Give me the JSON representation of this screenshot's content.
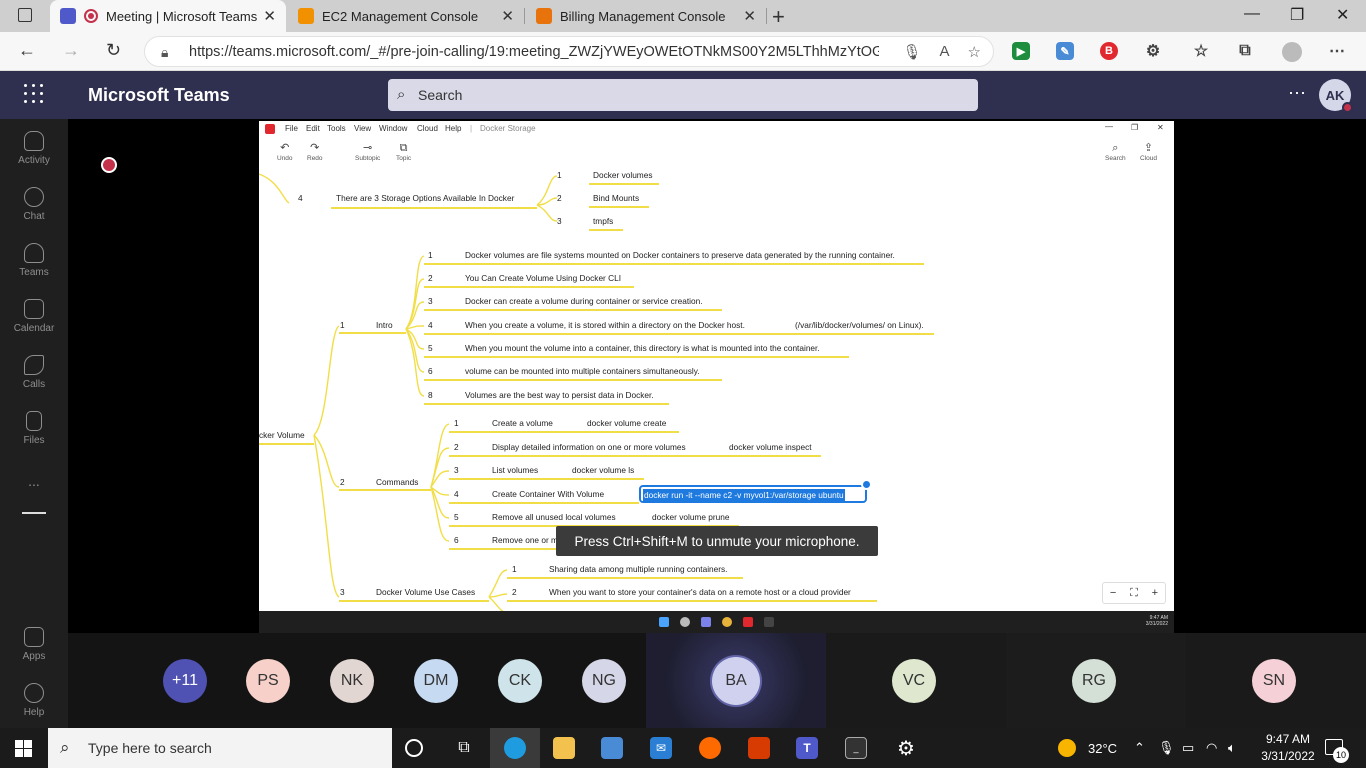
{
  "browser": {
    "tabs": [
      {
        "label": "Meeting | Microsoft Teams",
        "active": true
      },
      {
        "label": "EC2 Management Console",
        "active": false
      },
      {
        "label": "Billing Management Console",
        "active": false
      }
    ],
    "url": "https://teams.microsoft.com/_#/pre-join-calling/19:meeting_ZWZjYWEyOWEtOTNkMS00Y2M5LThhMzYtOGY..."
  },
  "teams": {
    "title": "Microsoft Teams",
    "search_placeholder": "Search",
    "user_initials": "AK",
    "rail": [
      {
        "label": "Activity"
      },
      {
        "label": "Chat"
      },
      {
        "label": "Teams"
      },
      {
        "label": "Calendar"
      },
      {
        "label": "Calls"
      },
      {
        "label": "Files"
      },
      {
        "label": "Apps"
      },
      {
        "label": "Help"
      }
    ],
    "more_label": "..."
  },
  "shared_app": {
    "menus": [
      "File",
      "Edit",
      "Tools",
      "View",
      "Window",
      "Cloud",
      "Help"
    ],
    "document_title": "Docker Storage",
    "toolbar": [
      {
        "label": "Undo",
        "icon": "undo-icon"
      },
      {
        "label": "Redo",
        "icon": "redo-icon"
      },
      {
        "label": "Subtopic",
        "icon": "subtopic-icon"
      },
      {
        "label": "Topic",
        "icon": "topic-icon"
      },
      {
        "label": "Search",
        "icon": "search-icon"
      },
      {
        "label": "Cloud",
        "icon": "cloud-upload-icon"
      }
    ],
    "mindmap": {
      "storage": {
        "num": "4",
        "title": "There are 3 Storage Options Available In Docker",
        "items": [
          {
            "num": "1",
            "text": "Docker volumes"
          },
          {
            "num": "2",
            "text": "Bind Mounts"
          },
          {
            "num": "3",
            "text": "tmpfs"
          }
        ]
      },
      "root": "cker Volume",
      "intro": {
        "num": "1",
        "title": "Intro",
        "items": [
          {
            "num": "1",
            "text": "Docker volumes are file systems mounted on Docker containers to preserve data generated by the running container."
          },
          {
            "num": "2",
            "text": "You Can Create Volume Using Docker CLI"
          },
          {
            "num": "3",
            "text": "Docker can create a volume during container or service creation."
          },
          {
            "num": "4",
            "text": "When you create a volume, it is stored within a directory on the Docker host.",
            "extra": "(/var/lib/docker/volumes/ on Linux)."
          },
          {
            "num": "5",
            "text": "When you mount the volume into a container, this directory is what is mounted into the container."
          },
          {
            "num": "6",
            "text": "volume can be mounted into multiple containers simultaneously."
          },
          {
            "num": "8",
            "text": "Volumes are the best way to persist data in Docker."
          }
        ]
      },
      "commands": {
        "num": "2",
        "title": "Commands",
        "items": [
          {
            "num": "1",
            "text": "Create a volume",
            "cmd": "docker volume create"
          },
          {
            "num": "2",
            "text": "Display detailed information on one or more volumes",
            "cmd": "docker volume inspect"
          },
          {
            "num": "3",
            "text": "List volumes",
            "cmd": "docker volume ls"
          },
          {
            "num": "4",
            "text": "Create Container With Volume",
            "cmd": "docker run -it --name c2 -v myvol1:/var/storage  ubuntu"
          },
          {
            "num": "5",
            "text": "Remove all unused local volumes",
            "cmd": "docker volume prune"
          },
          {
            "num": "6",
            "text": "Remove one or m",
            "cmd": ""
          }
        ]
      },
      "usecases": {
        "num": "3",
        "title": "Docker Volume Use Cases",
        "items": [
          {
            "num": "1",
            "text": "Sharing data among multiple running containers."
          },
          {
            "num": "2",
            "text": "When you want to store your container's data on a remote host or a cloud provider"
          }
        ]
      }
    },
    "zoom_controls": [
      "−",
      "⛶",
      "+"
    ],
    "inner_clock_time": "9:47 AM",
    "inner_clock_date": "3/31/2022"
  },
  "toast": "Press Ctrl+Shift+M to unmute your microphone.",
  "participants": [
    {
      "initials": "+11",
      "bg": "#4f52b2",
      "fg": "#ffffff"
    },
    {
      "initials": "PS",
      "bg": "#f6d0c9",
      "fg": "#333333"
    },
    {
      "initials": "NK",
      "bg": "#e2d6d3",
      "fg": "#333333"
    },
    {
      "initials": "DM",
      "bg": "#c6daf2",
      "fg": "#333333"
    },
    {
      "initials": "CK",
      "bg": "#cfe3ea",
      "fg": "#333333"
    },
    {
      "initials": "NG",
      "bg": "#d5d7e8",
      "fg": "#333333"
    },
    {
      "initials": "BA",
      "bg": "#cfd1ee",
      "fg": "#333333"
    },
    {
      "initials": "VC",
      "bg": "#dfe8cf",
      "fg": "#333333"
    },
    {
      "initials": "RG",
      "bg": "#d4e0d6",
      "fg": "#333333"
    },
    {
      "initials": "SN",
      "bg": "#f5d0d6",
      "fg": "#333333"
    }
  ],
  "taskbar": {
    "search_placeholder": "Type here to search",
    "weather": "32°C",
    "time": "9:47 AM",
    "date": "3/31/2022",
    "notifications": "10"
  },
  "colors": {
    "teams_header": "#2f2f4f",
    "rail": "#1f1f1f",
    "branch_line": "#f1de47",
    "selection": "#1f7ae0",
    "recording": "#c4314b"
  }
}
